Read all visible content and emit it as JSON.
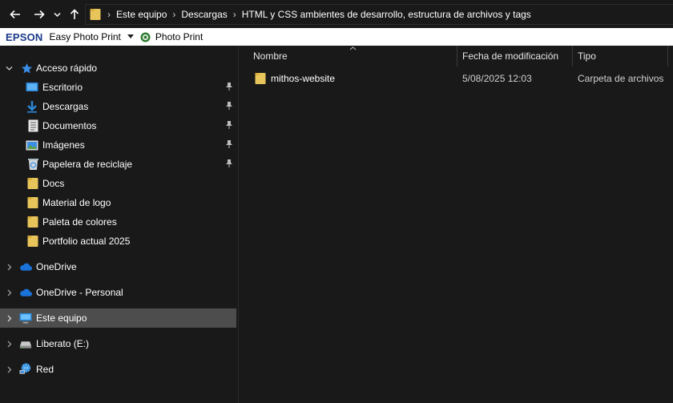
{
  "toolbar": {
    "back_icon": "arrow-left-icon",
    "forward_icon": "arrow-right-icon",
    "recent_icon": "chevron-down-icon",
    "up_icon": "arrow-up-icon"
  },
  "address_bar": {
    "crumbs": [
      "Este equipo",
      "Descargas",
      "HTML y CSS ambientes de desarrollo, estructura de archivos y tags"
    ]
  },
  "epson_bar": {
    "brand": "EPSON",
    "easy_photo_print": "Easy Photo Print",
    "photo_print": "Photo Print"
  },
  "sidebar": {
    "quick_access": "Acceso rápido",
    "quick_items": [
      {
        "label": "Escritorio",
        "icon": "desktop-icon",
        "pinned": true
      },
      {
        "label": "Descargas",
        "icon": "download-icon",
        "pinned": true
      },
      {
        "label": "Documentos",
        "icon": "document-icon",
        "pinned": true
      },
      {
        "label": "Imágenes",
        "icon": "pictures-icon",
        "pinned": true
      },
      {
        "label": "Papelera de reciclaje",
        "icon": "recycle-bin-icon",
        "pinned": true
      },
      {
        "label": "Docs",
        "icon": "folder-icon",
        "pinned": false
      },
      {
        "label": "Material de logo",
        "icon": "folder-icon",
        "pinned": false
      },
      {
        "label": "Paleta de colores",
        "icon": "folder-icon",
        "pinned": false
      },
      {
        "label": "Portfolio actual 2025",
        "icon": "folder-icon",
        "pinned": false
      }
    ],
    "roots": [
      {
        "label": "OneDrive",
        "icon": "cloud-icon"
      },
      {
        "label": "OneDrive - Personal",
        "icon": "cloud-icon"
      },
      {
        "label": "Este equipo",
        "icon": "computer-icon"
      },
      {
        "label": "Liberato (E:)",
        "icon": "drive-icon"
      },
      {
        "label": "Red",
        "icon": "network-icon"
      }
    ]
  },
  "columns": {
    "name": "Nombre",
    "modified": "Fecha de modificación",
    "type": "Tipo"
  },
  "files": [
    {
      "name": "mithos-website",
      "modified": "5/08/2025 12:03",
      "type": "Carpeta de archivos"
    }
  ],
  "colors": {
    "background": "#191919",
    "selected": "#4d4d4d",
    "folder": "#e8c55a",
    "accent": "#3a8ee6"
  }
}
